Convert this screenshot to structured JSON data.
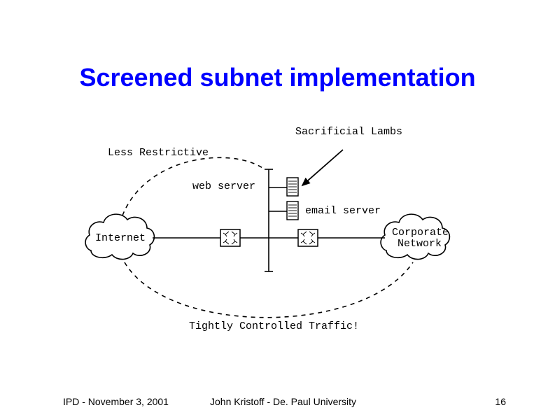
{
  "title": "Screened subnet implementation",
  "labels": {
    "sacrificial": "Sacrificial Lambs",
    "less_restrictive": "Less Restrictive",
    "web_server": "web server",
    "email_server": "email server",
    "internet": "Internet",
    "corporate1": "Corporate",
    "corporate2": "Network",
    "tightly": "Tightly Controlled Traffic!"
  },
  "footer": {
    "left": "IPD - November 3, 2001",
    "center": "John Kristoff - De. Paul University",
    "right": "16"
  }
}
